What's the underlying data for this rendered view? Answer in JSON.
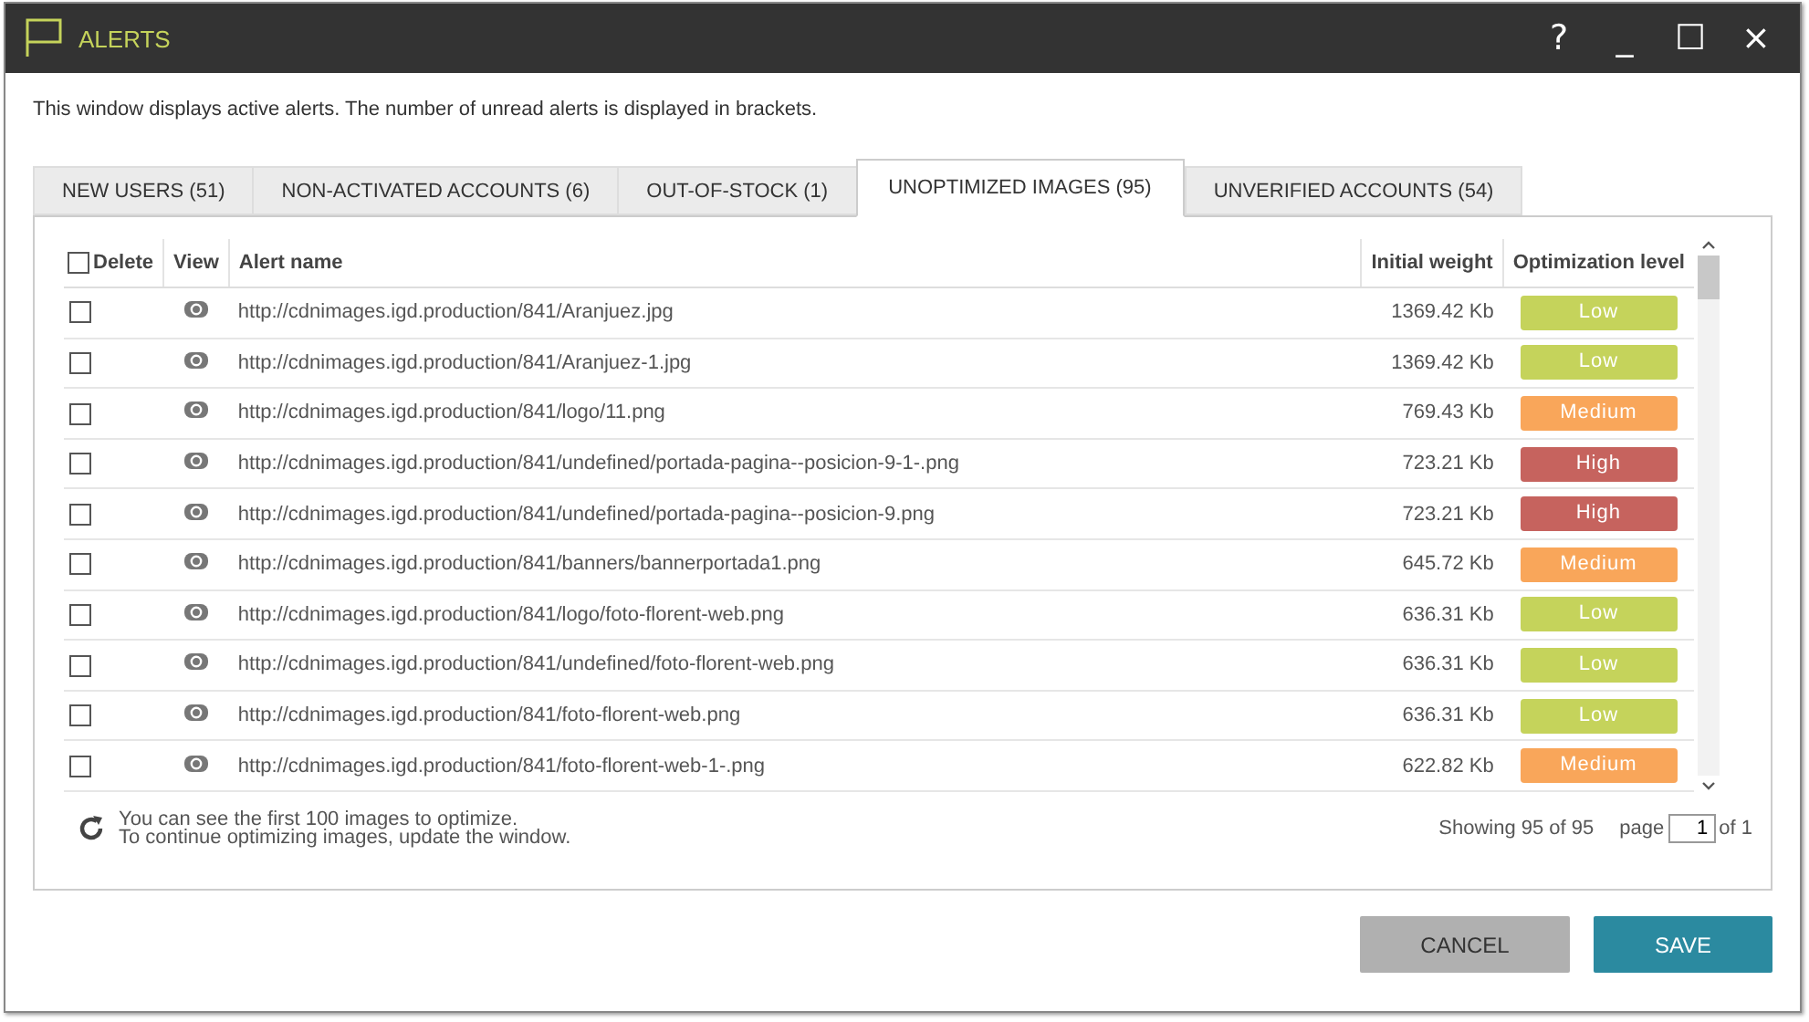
{
  "window": {
    "title": "ALERTS",
    "controls": [
      "?",
      "_",
      "☐",
      "×"
    ]
  },
  "description": "This window displays active alerts. The number of unread alerts is displayed in brackets.",
  "tabs": [
    {
      "label": "NEW USERS (51)",
      "selected": false
    },
    {
      "label": "NON-ACTIVATED ACCOUNTS (6)",
      "selected": false
    },
    {
      "label": "OUT-OF-STOCK (1)",
      "selected": false
    },
    {
      "label": "UNOPTIMIZED IMAGES (95)",
      "selected": true
    },
    {
      "label": "UNVERIFIED ACCOUNTS (54)",
      "selected": false
    }
  ],
  "table": {
    "select_all_checked": false,
    "columns": [
      "Delete",
      "View",
      "Alert name",
      "Initial weight",
      "Optimization level"
    ],
    "rows": [
      {
        "checked": false,
        "name": "http://cdnimages.igd.production/841/Aranjuez.jpg",
        "weight": "1369.42 Kb",
        "level": "Low",
        "color": "#c5d35b"
      },
      {
        "checked": false,
        "name": "http://cdnimages.igd.production/841/Aranjuez-1.jpg",
        "weight": "1369.42 Kb",
        "level": "Low",
        "color": "#c5d35b"
      },
      {
        "checked": false,
        "name": "http://cdnimages.igd.production/841/logo/11.png",
        "weight": "769.43 Kb",
        "level": "Medium",
        "color": "#f9a65a"
      },
      {
        "checked": false,
        "name": "http://cdnimages.igd.production/841/undefined/portada-pagina--posicion-9-1-.png",
        "weight": "723.21 Kb",
        "level": "High",
        "color": "#c6635e"
      },
      {
        "checked": false,
        "name": "http://cdnimages.igd.production/841/undefined/portada-pagina--posicion-9.png",
        "weight": "723.21 Kb",
        "level": "High",
        "color": "#c6635e"
      },
      {
        "checked": false,
        "name": "http://cdnimages.igd.production/841/banners/bannerportada1.png",
        "weight": "645.72 Kb",
        "level": "Medium",
        "color": "#f9a65a"
      },
      {
        "checked": false,
        "name": "http://cdnimages.igd.production/841/logo/foto-florent-web.png",
        "weight": "636.31 Kb",
        "level": "Low",
        "color": "#c5d35b"
      },
      {
        "checked": false,
        "name": "http://cdnimages.igd.production/841/undefined/foto-florent-web.png",
        "weight": "636.31 Kb",
        "level": "Low",
        "color": "#c5d35b"
      },
      {
        "checked": false,
        "name": "http://cdnimages.igd.production/841/foto-florent-web.png",
        "weight": "636.31 Kb",
        "level": "Low",
        "color": "#c5d35b"
      },
      {
        "checked": false,
        "name": "http://cdnimages.igd.production/841/foto-florent-web-1-.png",
        "weight": "622.82 Kb",
        "level": "Medium",
        "color": "#f9a65a"
      }
    ]
  },
  "footer": {
    "notice": [
      "You can see the first 100 images to optimize.",
      "To continue optimizing images, update the window."
    ],
    "showing": "Showing 95 of 95",
    "page_label": "page",
    "page": "1",
    "page_total": "of 1"
  },
  "buttons": [
    {
      "label": "CANCEL",
      "kind": "secondary"
    },
    {
      "label": "SAVE",
      "kind": "primary"
    }
  ]
}
